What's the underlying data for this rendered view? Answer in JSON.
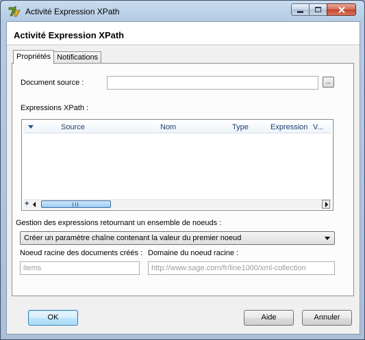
{
  "window": {
    "title": "Activité Expression XPath",
    "icon": "app-pen-icon"
  },
  "header": {
    "title": "Activité Expression XPath"
  },
  "tabs": [
    {
      "label": "Propriétés",
      "active": true
    },
    {
      "label": "Notifications",
      "active": false
    }
  ],
  "properties": {
    "source_label": "Document source :",
    "source_value": "",
    "browse_label": "...",
    "xpath_label": "Expressions XPath :",
    "grid_columns": [
      "Source",
      "Nom",
      "Type",
      "Expression",
      "V..."
    ],
    "grid_rows": [],
    "nodeset_label": "Gestion des expressions retournant un ensemble de noeuds :",
    "nodeset_selected": "Créer un paramètre chaîne contenant la valeur du premier noeud",
    "root_node_label": "Noeud racine des documents créés :",
    "root_node_placeholder": "items",
    "root_domain_label": "Domaine du noeud racine :",
    "root_domain_placeholder": "http://www.sage.com/fr/line1000/xml-collection"
  },
  "footer": {
    "ok_label": "OK",
    "help_label": "Aide",
    "cancel_label": "Annuler"
  }
}
